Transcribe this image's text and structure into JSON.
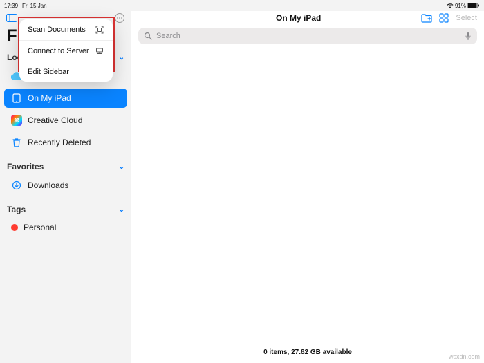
{
  "status_bar": {
    "time": "17:39",
    "date": "Fri 15 Jan",
    "battery_pct": "91%"
  },
  "sidebar": {
    "title": "Fil",
    "sections": {
      "locations": {
        "label": "Locations"
      },
      "favorites": {
        "label": "Favorites"
      },
      "tags": {
        "label": "Tags"
      }
    },
    "items": {
      "icloud": {
        "label": "iCloud Drive"
      },
      "onmyipad": {
        "label": "On My iPad"
      },
      "creativecloud": {
        "label": "Creative Cloud"
      },
      "recentlydeleted": {
        "label": "Recently Deleted"
      },
      "downloads": {
        "label": "Downloads"
      },
      "personal": {
        "label": "Personal",
        "color": "#ff3b30"
      }
    }
  },
  "popup": {
    "scan": "Scan Documents",
    "connect": "Connect to Server",
    "edit": "Edit Sidebar"
  },
  "content": {
    "title": "On My iPad",
    "search_placeholder": "Search",
    "select_label": "Select",
    "footer": "0 items, 27.82 GB available"
  },
  "watermark": "wsxdn.com"
}
